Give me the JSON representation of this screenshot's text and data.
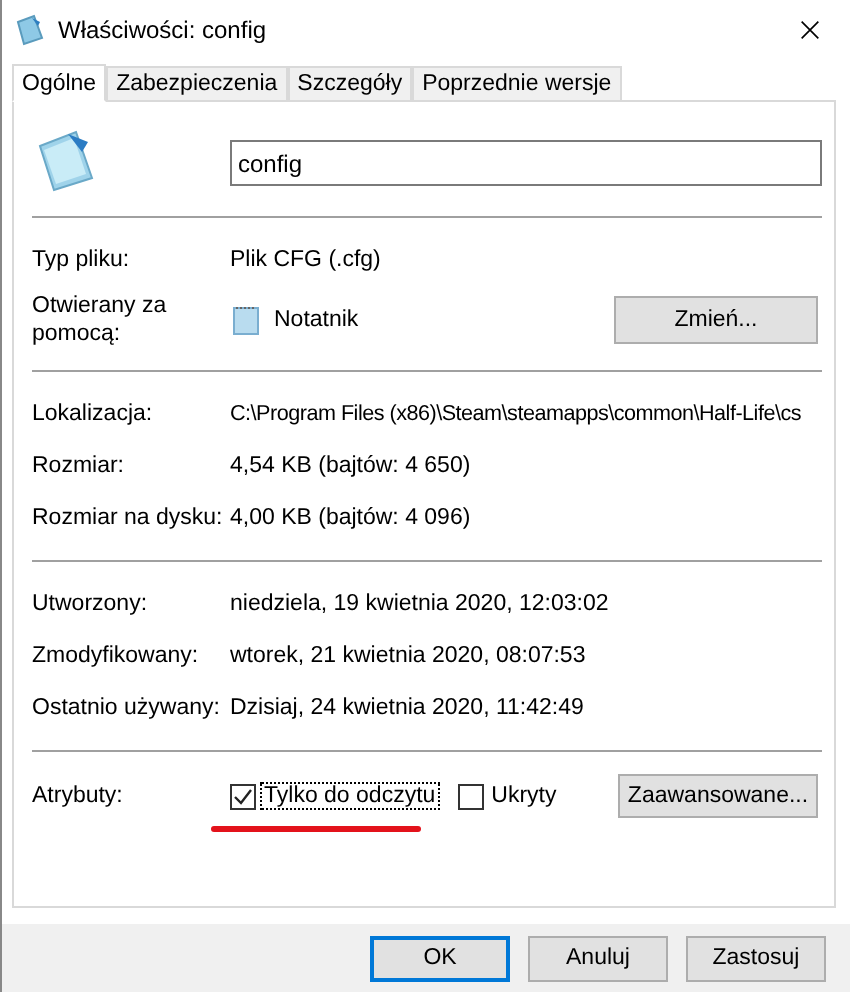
{
  "window": {
    "title": "Właściwości: config"
  },
  "tabs": [
    {
      "label": "Ogólne",
      "selected": true
    },
    {
      "label": "Zabezpieczenia",
      "selected": false
    },
    {
      "label": "Szczegóły",
      "selected": false
    },
    {
      "label": "Poprzednie wersje",
      "selected": false
    }
  ],
  "name_field": {
    "value": "config"
  },
  "file_type": {
    "label": "Typ pliku:",
    "value": "Plik CFG (.cfg)"
  },
  "opens_with": {
    "label": "Otwierany za pomocą:",
    "app": "Notatnik",
    "button": "Zmień..."
  },
  "location_group": [
    {
      "label": "Lokalizacja:",
      "value": "C:\\Program Files (x86)\\Steam\\steamapps\\common\\Half-Life\\cs"
    },
    {
      "label": "Rozmiar:",
      "value": "4,54 KB (bajtów: 4 650)"
    },
    {
      "label": "Rozmiar na dysku:",
      "value": "4,00 KB (bajtów: 4 096)"
    }
  ],
  "dates_group": [
    {
      "label": "Utworzony:",
      "value": "niedziela, 19 kwietnia 2020, 12:03:02"
    },
    {
      "label": "Zmodyfikowany:",
      "value": "wtorek, 21 kwietnia 2020, 08:07:53"
    },
    {
      "label": "Ostatnio używany:",
      "value": "Dzisiaj, 24 kwietnia 2020, 11:42:49"
    }
  ],
  "attributes": {
    "label": "Atrybuty:",
    "checkboxes": [
      {
        "label": "Tylko do odczytu",
        "checked": true,
        "focused": true,
        "highlighted": true
      },
      {
        "label": "Ukryty",
        "checked": false,
        "focused": false,
        "highlighted": false
      }
    ],
    "button": "Zaawansowane..."
  },
  "buttons": [
    {
      "label": "OK",
      "default": true
    },
    {
      "label": "Anuluj",
      "default": false
    },
    {
      "label": "Zastosuj",
      "default": false
    }
  ]
}
